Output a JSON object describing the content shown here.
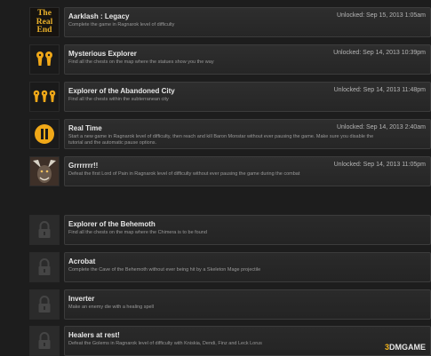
{
  "achievements": [
    {
      "title": "Aarklash : Legacy",
      "desc": "Complete the game in Ragnarok level of difficulty",
      "unlocked": "Unlocked: Sep 15, 2013 1:05am",
      "icon": "the-real-end-icon",
      "icon_text": [
        "The",
        "Real",
        "End"
      ]
    },
    {
      "title": "Mysterious Explorer",
      "desc": "Find all the chests on the map where the statues show you the way",
      "unlocked": "Unlocked: Sep 14, 2013 10:39pm",
      "icon": "two-keyholes-icon"
    },
    {
      "title": "Explorer of the Abandoned City",
      "desc": "Find all the chests within the subterranean city",
      "unlocked": "Unlocked: Sep 14, 2013 11:48pm",
      "icon": "three-keyholes-icon"
    },
    {
      "title": "Real Time",
      "desc": "Start a new game in Ragnarok level of difficulty, then reach and kill Baron Monstar without ever pausing the game. Make sure you disable the tutorial and the automatic pause options.",
      "unlocked": "Unlocked: Sep 14, 2013 2:40am",
      "icon": "pause-icon"
    },
    {
      "title": "Grrrrrrr!!",
      "desc": "Defeat the first Lord of Pain in Ragnarok level of difficulty without ever pausing the game during the combat",
      "unlocked": "Unlocked: Sep 14, 2013 11:05pm",
      "icon": "beast-portrait-icon"
    },
    {
      "title": "Explorer of the Behemoth",
      "desc": "Find all the chests on the map where the Chimera is to be found",
      "unlocked": "",
      "icon": "lock-icon"
    },
    {
      "title": "Acrobat",
      "desc": "Complete the Cave of the Behemoth without ever being hit by a Skeleton Mage projectile",
      "unlocked": "",
      "icon": "lock-icon"
    },
    {
      "title": "Inverter",
      "desc": "Make an enemy die with a healing spell",
      "unlocked": "",
      "icon": "lock-icon"
    },
    {
      "title": "Healers at rest!",
      "desc": "Defeat the Golems in Ragnarok level of difficulty with Kniskia, Dendi, Finz and Leck Lorus",
      "unlocked": "",
      "icon": "lock-icon"
    }
  ],
  "watermark": {
    "n3": "3",
    "rest": "DMGAME"
  },
  "colors": {
    "gold": "#f0a818",
    "card_border": "#3c3c3c",
    "background": "#1d1d1d"
  }
}
